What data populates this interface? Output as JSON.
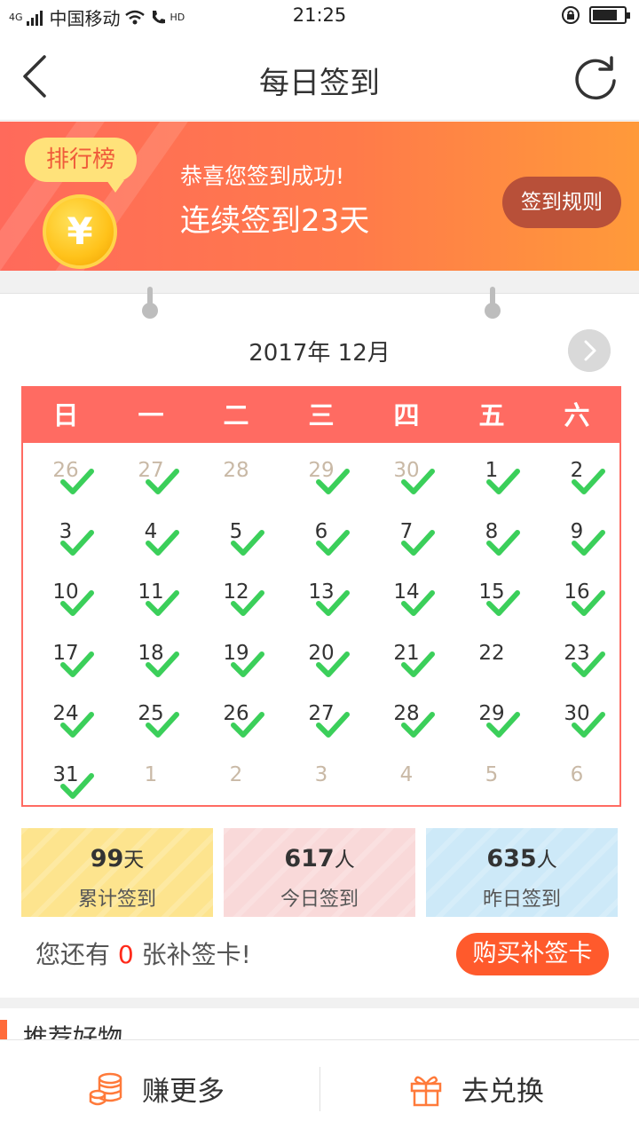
{
  "status": {
    "network": "4G",
    "carrier": "中国移动",
    "hd": "HD",
    "time": "21:25",
    "battery_level": 0.8
  },
  "nav": {
    "title": "每日签到"
  },
  "banner": {
    "rank_label": "排行榜",
    "coin_symbol": "¥",
    "message": "恭喜您签到成功!",
    "streak": "连续签到23天",
    "rules_label": "签到规则"
  },
  "calendar": {
    "month_title": "2017年 12月",
    "weekdays": [
      "日",
      "一",
      "二",
      "三",
      "四",
      "五",
      "六"
    ],
    "days": [
      {
        "n": "26",
        "other": true,
        "checked": true
      },
      {
        "n": "27",
        "other": true,
        "checked": true
      },
      {
        "n": "28",
        "other": true,
        "checked": false
      },
      {
        "n": "29",
        "other": true,
        "checked": true
      },
      {
        "n": "30",
        "other": true,
        "checked": true
      },
      {
        "n": "1",
        "other": false,
        "checked": true
      },
      {
        "n": "2",
        "other": false,
        "checked": true
      },
      {
        "n": "3",
        "other": false,
        "checked": true
      },
      {
        "n": "4",
        "other": false,
        "checked": true
      },
      {
        "n": "5",
        "other": false,
        "checked": true
      },
      {
        "n": "6",
        "other": false,
        "checked": true
      },
      {
        "n": "7",
        "other": false,
        "checked": true
      },
      {
        "n": "8",
        "other": false,
        "checked": true
      },
      {
        "n": "9",
        "other": false,
        "checked": true
      },
      {
        "n": "10",
        "other": false,
        "checked": true
      },
      {
        "n": "11",
        "other": false,
        "checked": true
      },
      {
        "n": "12",
        "other": false,
        "checked": true
      },
      {
        "n": "13",
        "other": false,
        "checked": true
      },
      {
        "n": "14",
        "other": false,
        "checked": true
      },
      {
        "n": "15",
        "other": false,
        "checked": true
      },
      {
        "n": "16",
        "other": false,
        "checked": true
      },
      {
        "n": "17",
        "other": false,
        "checked": true
      },
      {
        "n": "18",
        "other": false,
        "checked": true
      },
      {
        "n": "19",
        "other": false,
        "checked": true
      },
      {
        "n": "20",
        "other": false,
        "checked": true
      },
      {
        "n": "21",
        "other": false,
        "checked": true
      },
      {
        "n": "22",
        "other": false,
        "checked": false
      },
      {
        "n": "23",
        "other": false,
        "checked": true
      },
      {
        "n": "24",
        "other": false,
        "checked": true
      },
      {
        "n": "25",
        "other": false,
        "checked": true
      },
      {
        "n": "26",
        "other": false,
        "checked": true
      },
      {
        "n": "27",
        "other": false,
        "checked": true
      },
      {
        "n": "28",
        "other": false,
        "checked": true
      },
      {
        "n": "29",
        "other": false,
        "checked": true
      },
      {
        "n": "30",
        "other": false,
        "checked": true
      },
      {
        "n": "31",
        "other": false,
        "checked": true
      },
      {
        "n": "1",
        "other": true,
        "checked": false
      },
      {
        "n": "2",
        "other": true,
        "checked": false
      },
      {
        "n": "3",
        "other": true,
        "checked": false
      },
      {
        "n": "4",
        "other": true,
        "checked": false
      },
      {
        "n": "5",
        "other": true,
        "checked": false
      },
      {
        "n": "6",
        "other": true,
        "checked": false
      }
    ]
  },
  "stats": [
    {
      "value": "99",
      "unit": "天",
      "label": "累计签到",
      "color": "#fde48e"
    },
    {
      "value": "617",
      "unit": "人",
      "label": "今日签到",
      "color": "#f9d9d9"
    },
    {
      "value": "635",
      "unit": "人",
      "label": "昨日签到",
      "color": "#cde9f8"
    }
  ],
  "makeup": {
    "prefix": "您还有 ",
    "count": "0",
    "suffix": " 张补签卡!",
    "buy_label": "购买补签卡"
  },
  "recommend": {
    "title": "推荐好物"
  },
  "bottom": {
    "earn_label": "赚更多",
    "exchange_label": "去兑换"
  },
  "colors": {
    "accent": "#ff6b62",
    "check": "#3bcf5a",
    "buy": "#ff5a2c"
  }
}
